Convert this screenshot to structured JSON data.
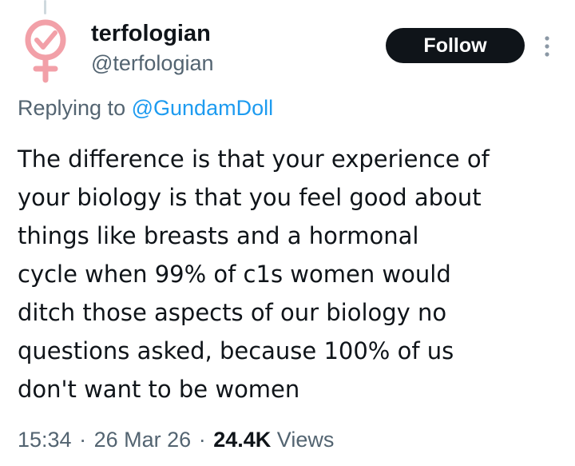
{
  "author": {
    "display_name": "terfologian",
    "handle": "@terfologian",
    "avatar_icon": "venus-symbol-checkmark-icon",
    "avatar_color": "#f2a0a8"
  },
  "follow_button": {
    "label": "Follow"
  },
  "more_button": {
    "icon": "vertical-ellipsis-icon"
  },
  "reply_context": {
    "prefix": "Replying to",
    "mention": "@GundamDoll"
  },
  "tweet": {
    "text_lines": [
      "The difference is that your experience of",
      "your biology is that you feel good about",
      "things like breasts and a hormonal",
      "cycle when 99% of c1s women would",
      "ditch those aspects of our biology no",
      "questions asked, because 100% of us",
      "don't want to be women"
    ]
  },
  "meta": {
    "time": "15:34",
    "separator": "·",
    "date": "26 Mar 26",
    "views_count": "24.4K",
    "views_label": "Views"
  },
  "colors": {
    "text_primary": "#0f1419",
    "text_secondary": "#536471",
    "link": "#1d9bf0",
    "follow_bg": "#0f1419"
  }
}
